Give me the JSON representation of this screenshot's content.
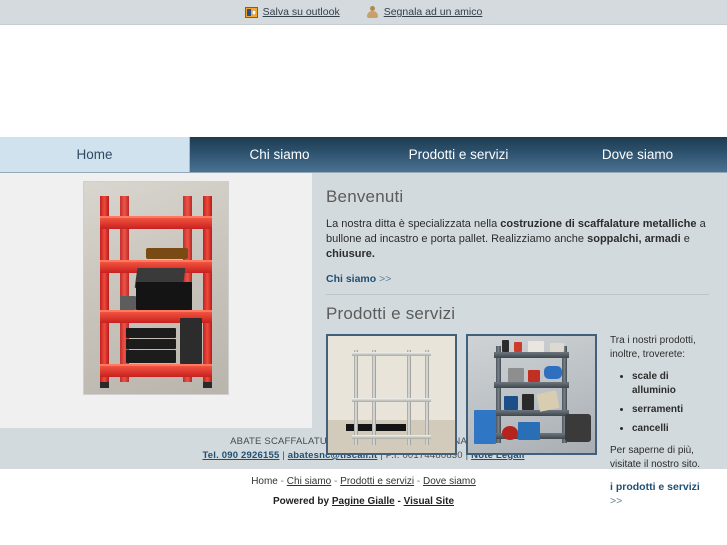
{
  "topbar": {
    "links": [
      {
        "label": "Salva su outlook",
        "icon": "outlook-icon"
      },
      {
        "label": "Segnala ad un amico",
        "icon": "friend-icon"
      }
    ]
  },
  "nav": {
    "items": [
      {
        "label": "Home",
        "active": true
      },
      {
        "label": "Chi siamo",
        "active": false
      },
      {
        "label": "Prodotti e servizi",
        "active": false
      },
      {
        "label": "Dove siamo",
        "active": false
      }
    ]
  },
  "hero": {
    "image_alt": "red metal shelving unit with hi-fi equipment"
  },
  "welcome": {
    "heading": "Benvenuti",
    "text_part1": "La nostra ditta è specializzata nella ",
    "text_bold1": "costruzione di scaffalature metalliche",
    "text_part2": " a bullone ad incastro e porta pallet. Realizziamo anche ",
    "text_bold2": "soppalchi, armadi",
    "text_part3": " e ",
    "text_bold3": "chiusure.",
    "link_label": "Chi siamo",
    "link_chevron": ">>"
  },
  "products": {
    "heading": "Prodotti e servizi",
    "image1_alt": "chrome wire shelving unit",
    "image2_alt": "grey metal shelving unit with garage goods",
    "intro": "Tra i nostri prodotti, inoltre, troverete:",
    "bullets": [
      "scale di alluminio",
      "serramenti",
      "cancelli"
    ],
    "outro": "Per saperne di più, visitate il nostro sito.",
    "link_label": "i prodotti e servizi",
    "link_chevron": ">>"
  },
  "footer": {
    "company_line": "ABATE SCAFFALATURE | V. BLASCO 86 - MESSINA (ME) -",
    "phone": "Tel. 090 2926155",
    "email": "abatesnc@tiscali.it",
    "vat": "P.I. 00174480830",
    "legal": "Note Legali",
    "sep": "|",
    "nav_links": [
      "Home",
      "Chi siamo",
      "Prodotti e servizi",
      "Dove siamo"
    ],
    "nav_sep": "-",
    "powered_prefix": "Powered by",
    "powered_brand1": "Pagine Gialle",
    "powered_dash": "-",
    "powered_brand2": "Visual Site"
  },
  "colors": {
    "nav_dark": "#2d5370",
    "nav_active": "#cfe2ee",
    "panel": "#d3dade",
    "link": "#1f4f73",
    "topbar": "#d4dade"
  }
}
